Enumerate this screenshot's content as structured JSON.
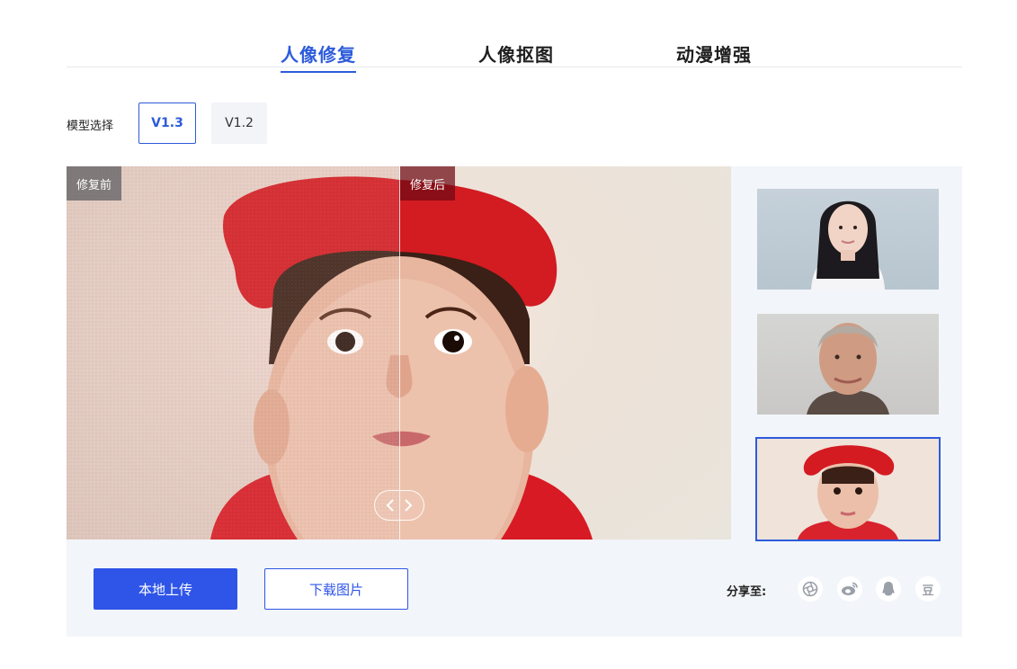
{
  "tabs": [
    {
      "label": "人像修复",
      "active": true
    },
    {
      "label": "人像抠图",
      "active": false
    },
    {
      "label": "动漫增强",
      "active": false
    }
  ],
  "model": {
    "label": "模型选择",
    "options": [
      {
        "label": "V1.3",
        "selected": true
      },
      {
        "label": "V1.2",
        "selected": false
      }
    ]
  },
  "compare": {
    "before_label": "修复前",
    "after_label": "修复后",
    "split_fraction": 0.5
  },
  "samples": [
    {
      "name": "woman-portrait",
      "selected": false
    },
    {
      "name": "man-portrait",
      "selected": false
    },
    {
      "name": "baby-portrait",
      "selected": true
    }
  ],
  "actions": {
    "upload_label": "本地上传",
    "download_label": "下载图片"
  },
  "share": {
    "label": "分享至:",
    "icons": [
      "camera-aperture-icon",
      "weibo-icon",
      "qq-icon",
      "douban-icon"
    ],
    "douban_glyph": "豆"
  },
  "colors": {
    "accent": "#2d5bdb",
    "button_blue": "#2e55e8",
    "panel_bg": "#f2f5f9"
  }
}
